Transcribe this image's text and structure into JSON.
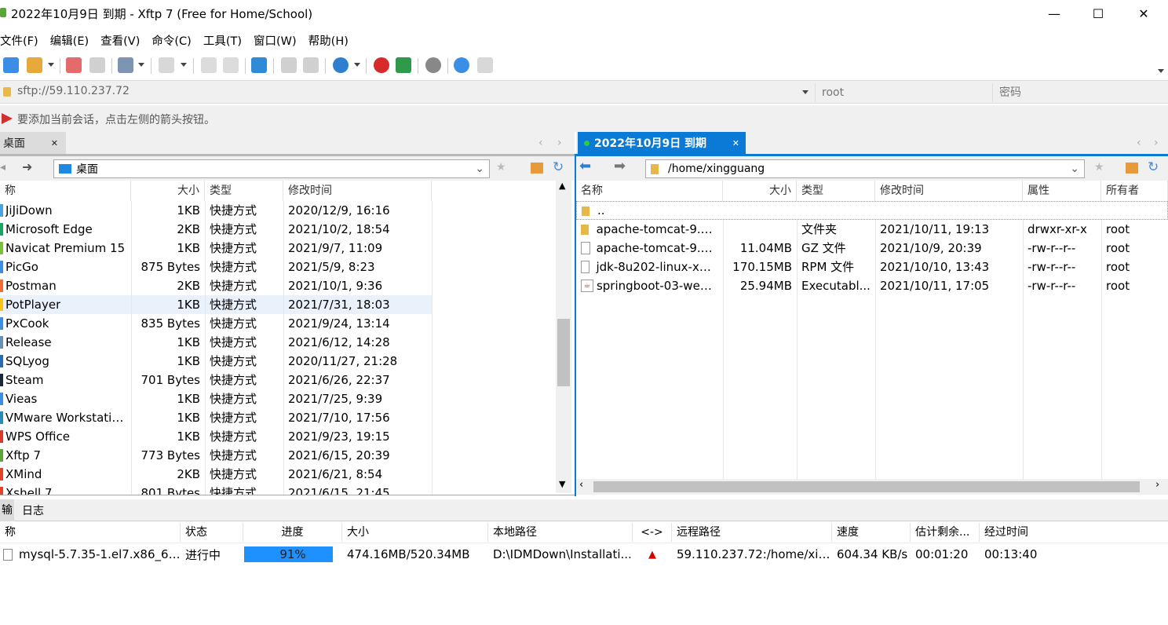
{
  "window": {
    "title": "2022年10月9日 到期 - Xftp 7 (Free for Home/School)",
    "minimize": "—",
    "maximize": "☐",
    "close": "✕"
  },
  "menu": [
    "文件(F)",
    "编辑(E)",
    "查看(V)",
    "命令(C)",
    "工具(T)",
    "窗口(W)",
    "帮助(H)"
  ],
  "address": {
    "url": "sftp://59.110.237.72",
    "user_placeholder": "root",
    "password_placeholder": "密码"
  },
  "hint": "要添加当前会话，点击左侧的箭头按钮。",
  "left": {
    "tab": "桌面",
    "path": "桌面",
    "columns": [
      "称",
      "大小",
      "类型",
      "修改时间"
    ],
    "files": [
      {
        "name": "JiJiDown",
        "size": "1KB",
        "type": "快捷方式",
        "mtime": "2020/12/9, 16:16",
        "color": "#4aa3df"
      },
      {
        "name": "Microsoft Edge",
        "size": "2KB",
        "type": "快捷方式",
        "mtime": "2021/10/2, 18:54",
        "color": "#1da462"
      },
      {
        "name": "Navicat Premium 15",
        "size": "1KB",
        "type": "快捷方式",
        "mtime": "2021/9/7, 11:09",
        "color": "#7bbf3a"
      },
      {
        "name": "PicGo",
        "size": "875 Bytes",
        "type": "快捷方式",
        "mtime": "2021/5/9, 8:23",
        "color": "#3b8ee0"
      },
      {
        "name": "Postman",
        "size": "2KB",
        "type": "快捷方式",
        "mtime": "2021/10/1, 9:36",
        "color": "#ef6c35"
      },
      {
        "name": "PotPlayer",
        "size": "1KB",
        "type": "快捷方式",
        "mtime": "2021/7/31, 18:03",
        "color": "#f5c518"
      },
      {
        "name": "PxCook",
        "size": "835 Bytes",
        "type": "快捷方式",
        "mtime": "2021/9/24, 13:14",
        "color": "#3b8ee0"
      },
      {
        "name": "Release",
        "size": "1KB",
        "type": "快捷方式",
        "mtime": "2021/6/12, 14:28",
        "color": "#6b8fb5"
      },
      {
        "name": "SQLyog",
        "size": "1KB",
        "type": "快捷方式",
        "mtime": "2020/11/27, 21:28",
        "color": "#2a6cb4"
      },
      {
        "name": "Steam",
        "size": "701 Bytes",
        "type": "快捷方式",
        "mtime": "2021/6/26, 22:37",
        "color": "#1b2838"
      },
      {
        "name": "Vieas",
        "size": "1KB",
        "type": "快捷方式",
        "mtime": "2021/7/25, 9:39",
        "color": "#3b8ee0"
      },
      {
        "name": "VMware Workstatio...",
        "size": "1KB",
        "type": "快捷方式",
        "mtime": "2021/7/10, 17:56",
        "color": "#2a8bb5"
      },
      {
        "name": "WPS Office",
        "size": "1KB",
        "type": "快捷方式",
        "mtime": "2021/9/23, 19:15",
        "color": "#d93a2b"
      },
      {
        "name": "Xftp 7",
        "size": "773 Bytes",
        "type": "快捷方式",
        "mtime": "2021/6/15, 20:39",
        "color": "#5aa43a"
      },
      {
        "name": "XMind",
        "size": "2KB",
        "type": "快捷方式",
        "mtime": "2021/6/21, 8:54",
        "color": "#e0442b"
      },
      {
        "name": "Xshell 7",
        "size": "801 Bytes",
        "type": "快捷方式",
        "mtime": "2021/6/15, 21:45",
        "color": "#e0442b"
      }
    ]
  },
  "right": {
    "tab": "2022年10月9日 到期",
    "path": "/home/xingguang",
    "columns": [
      "名称",
      "大小",
      "类型",
      "修改时间",
      "属性",
      "所有者"
    ],
    "parent": "..",
    "files": [
      {
        "name": "apache-tomcat-9.0....",
        "size": "",
        "type": "文件夹",
        "mtime": "2021/10/11, 19:13",
        "perm": "drwxr-xr-x",
        "owner": "root",
        "icon": "folder"
      },
      {
        "name": "apache-tomcat-9.0....",
        "size": "11.04MB",
        "type": "GZ 文件",
        "mtime": "2021/10/9, 20:39",
        "perm": "-rw-r--r--",
        "owner": "root",
        "icon": "file"
      },
      {
        "name": "jdk-8u202-linux-x64...",
        "size": "170.15MB",
        "type": "RPM 文件",
        "mtime": "2021/10/10, 13:43",
        "perm": "-rw-r--r--",
        "owner": "root",
        "icon": "file"
      },
      {
        "name": "springboot-03-web...",
        "size": "25.94MB",
        "type": "Executabl...",
        "mtime": "2021/10/11, 17:05",
        "perm": "-rw-r--r--",
        "owner": "root",
        "icon": "java"
      }
    ]
  },
  "transfer": {
    "tabs": [
      "输",
      "日志"
    ],
    "columns": [
      "称",
      "状态",
      "进度",
      "大小",
      "本地路径",
      "<->",
      "远程路径",
      "速度",
      "估计剩余...",
      "经过时间"
    ],
    "rows": [
      {
        "name": "mysql-5.7.35-1.el7.x86_64...",
        "status": "进行中",
        "progress": 91,
        "progress_label": "91%",
        "size": "474.16MB/520.34MB",
        "local": "D:\\IDMDown\\Installati...",
        "dir": "upload",
        "remote": "59.110.237.72:/home/xin...",
        "speed": "604.34 KB/s",
        "eta": "00:01:20",
        "elapsed": "00:13:40"
      }
    ]
  },
  "colors": {
    "accent": "#0078d7",
    "progress": "#1e90ff",
    "tab_active": "#0a7ad6"
  }
}
